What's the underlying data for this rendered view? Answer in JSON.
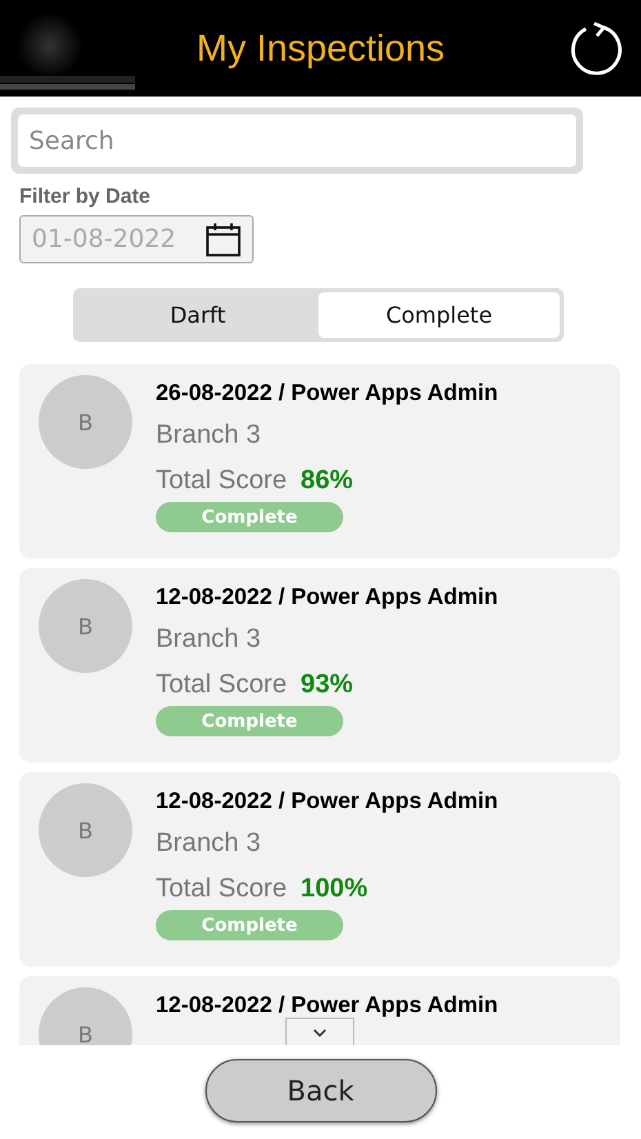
{
  "header": {
    "title": "My Inspections"
  },
  "search": {
    "placeholder": "Search"
  },
  "date_filter": {
    "label": "Filter by Date",
    "value": "01-08-2022"
  },
  "tabs": [
    {
      "label": "Darft",
      "selected": false
    },
    {
      "label": "Complete",
      "selected": true
    }
  ],
  "inspections": [
    {
      "avatar": "B",
      "title": "26-08-2022 / Power Apps Admin",
      "branch": "Branch 3",
      "score_label": "Total Score",
      "score": "86%",
      "status": "Complete"
    },
    {
      "avatar": "B",
      "title": "12-08-2022 / Power Apps Admin",
      "branch": "Branch 3",
      "score_label": "Total Score",
      "score": "93%",
      "status": "Complete"
    },
    {
      "avatar": "B",
      "title": "12-08-2022 / Power Apps Admin",
      "branch": "Branch 3",
      "score_label": "Total Score",
      "score": "100%",
      "status": "Complete"
    },
    {
      "avatar": "B",
      "title": "12-08-2022 / Power Apps Admin"
    }
  ],
  "back_button": "Back"
}
